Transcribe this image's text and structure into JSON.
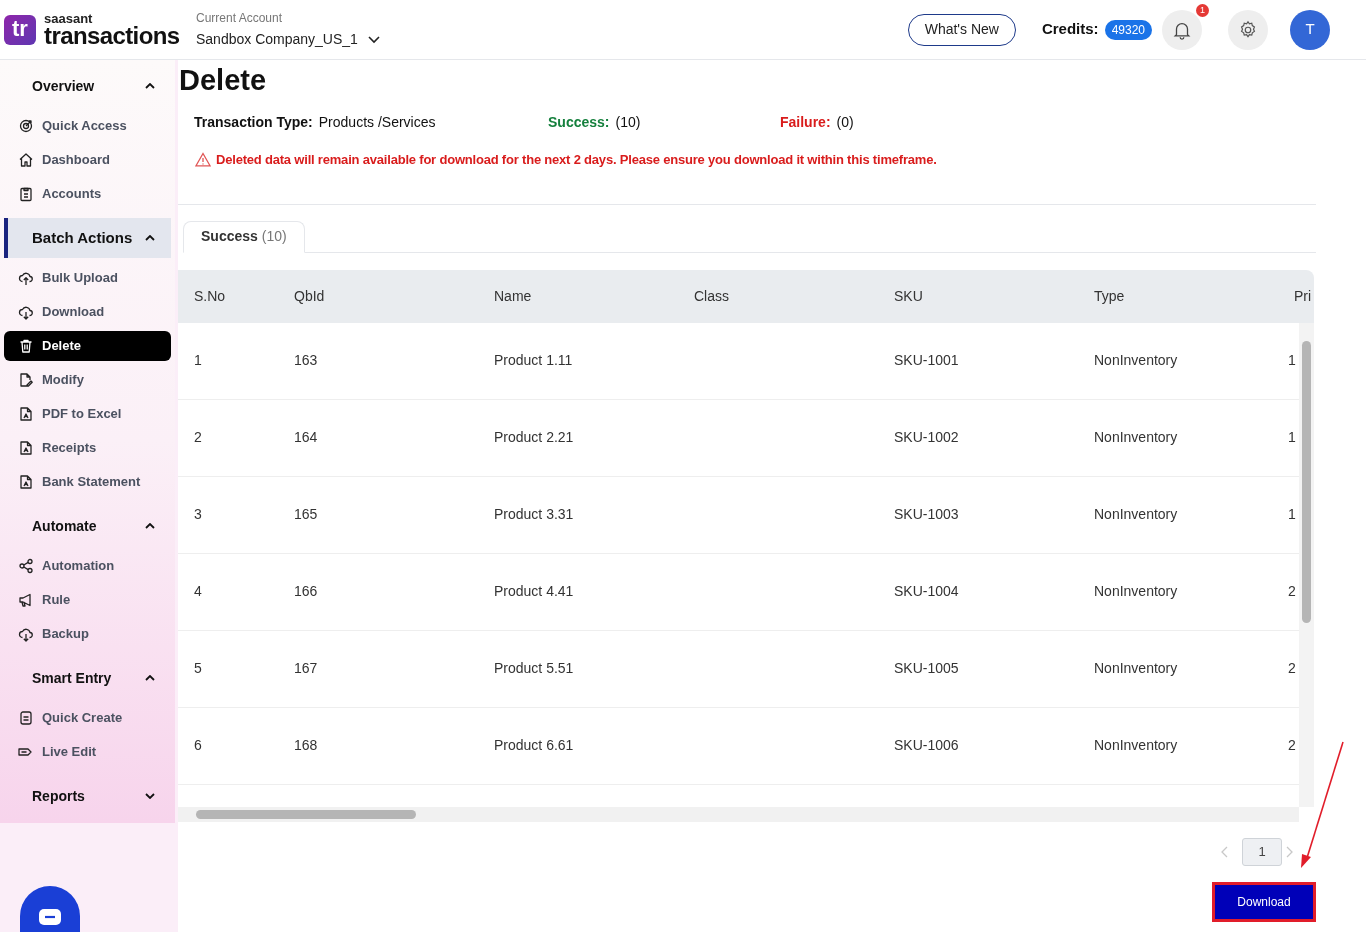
{
  "header": {
    "logo_mark": "tr",
    "logo_small": "saasant",
    "logo_text": "transactions",
    "account_label": "Current Account",
    "account_name": "Sandbox Company_US_1",
    "whats_new": "What's New",
    "credits_label": "Credits:",
    "credits": "49320",
    "notification_count": "1",
    "avatar": "T"
  },
  "sidebar": {
    "sections": [
      {
        "title": "Overview",
        "expanded": true,
        "selected": false,
        "items": [
          {
            "label": "Quick Access",
            "selected": false
          },
          {
            "label": "Dashboard",
            "selected": false
          },
          {
            "label": "Accounts",
            "selected": false
          }
        ]
      },
      {
        "title": "Batch Actions",
        "expanded": true,
        "selected": true,
        "items": [
          {
            "label": "Bulk Upload",
            "selected": false
          },
          {
            "label": "Download",
            "selected": false
          },
          {
            "label": "Delete",
            "selected": true
          },
          {
            "label": "Modify",
            "selected": false
          },
          {
            "label": "PDF to Excel",
            "selected": false
          },
          {
            "label": "Receipts",
            "selected": false
          },
          {
            "label": "Bank Statement",
            "selected": false
          }
        ]
      },
      {
        "title": "Automate",
        "expanded": true,
        "selected": false,
        "items": [
          {
            "label": "Automation",
            "selected": false
          },
          {
            "label": "Rule",
            "selected": false
          },
          {
            "label": "Backup",
            "selected": false
          }
        ]
      },
      {
        "title": "Smart Entry",
        "expanded": true,
        "selected": false,
        "items": [
          {
            "label": "Quick Create",
            "selected": false
          },
          {
            "label": "Live Edit",
            "selected": false
          }
        ]
      },
      {
        "title": "Reports",
        "expanded": false,
        "selected": false
      }
    ]
  },
  "page": {
    "title": "Delete",
    "transaction_type_label": "Transaction Type:",
    "transaction_type": "Products /Services",
    "success_label": "Success:",
    "success_count": "(10)",
    "failure_label": "Failure:",
    "failure_count": "(0)",
    "warning": "Deleted data will remain available for download for the next 2 days. Please ensure you download it within this timeframe."
  },
  "tabs": [
    {
      "label": "Success",
      "count": "(10)",
      "selected": true
    }
  ],
  "table": {
    "columns": [
      "S.No",
      "QbId",
      "Name",
      "Class",
      "SKU",
      "Type",
      "Pri"
    ],
    "rows": [
      [
        "1",
        "163",
        "Product 1.11",
        null,
        "SKU-1001",
        "NonInventory",
        "1"
      ],
      [
        "2",
        "164",
        "Product 2.21",
        null,
        "SKU-1002",
        "NonInventory",
        "1"
      ],
      [
        "3",
        "165",
        "Product 3.31",
        null,
        "SKU-1003",
        "NonInventory",
        "1"
      ],
      [
        "4",
        "166",
        "Product 4.41",
        null,
        "SKU-1004",
        "NonInventory",
        "2"
      ],
      [
        "5",
        "167",
        "Product 5.51",
        null,
        "SKU-1005",
        "NonInventory",
        "2"
      ],
      [
        "6",
        "168",
        "Product 6.61",
        null,
        "SKU-1006",
        "NonInventory",
        "2"
      ]
    ]
  },
  "pagination": {
    "pages": [
      {
        "label": "1",
        "selected": true
      }
    ]
  },
  "download_button": "Download"
}
